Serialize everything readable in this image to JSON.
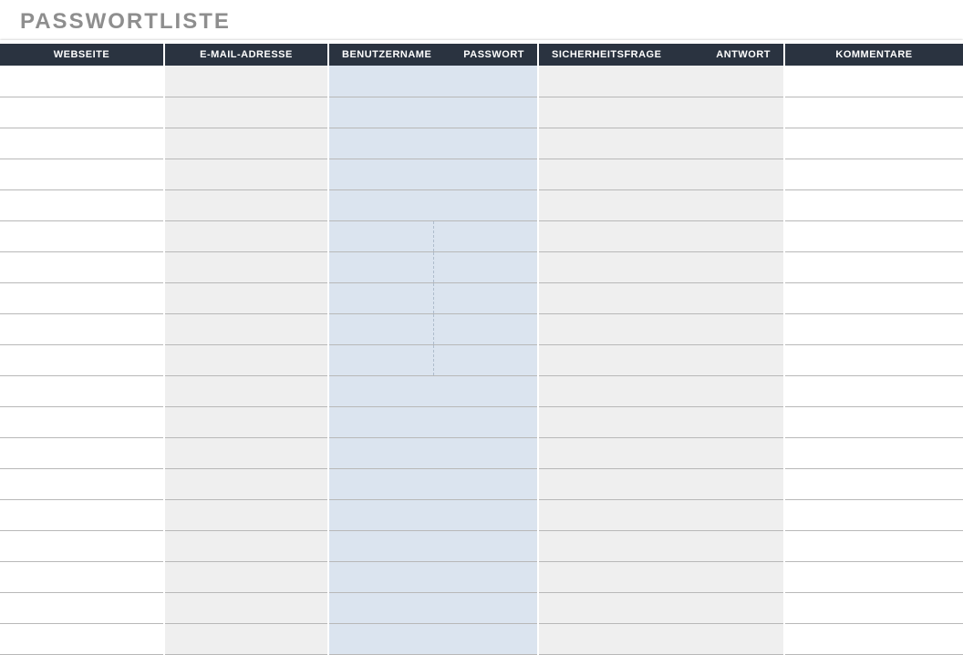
{
  "title": "PASSWORTLISTE",
  "headers": {
    "webseite": "WEBSEITE",
    "email": "E-MAIL-ADRESSE",
    "benutzername": "BENUTZERNAME",
    "passwort": "PASSWORT",
    "sicherheitsfrage": "SICHERHEITSFRAGE",
    "antwort": "ANTWORT",
    "kommentare": "KOMMENTARE"
  },
  "rows": [
    {
      "webseite": "",
      "email": "",
      "benutzername": "",
      "passwort": "",
      "sicherheitsfrage": "",
      "antwort": "",
      "kommentare": ""
    },
    {
      "webseite": "",
      "email": "",
      "benutzername": "",
      "passwort": "",
      "sicherheitsfrage": "",
      "antwort": "",
      "kommentare": ""
    },
    {
      "webseite": "",
      "email": "",
      "benutzername": "",
      "passwort": "",
      "sicherheitsfrage": "",
      "antwort": "",
      "kommentare": ""
    },
    {
      "webseite": "",
      "email": "",
      "benutzername": "",
      "passwort": "",
      "sicherheitsfrage": "",
      "antwort": "",
      "kommentare": ""
    },
    {
      "webseite": "",
      "email": "",
      "benutzername": "",
      "passwort": "",
      "sicherheitsfrage": "",
      "antwort": "",
      "kommentare": ""
    },
    {
      "webseite": "",
      "email": "",
      "benutzername": "",
      "passwort": "",
      "sicherheitsfrage": "",
      "antwort": "",
      "kommentare": ""
    },
    {
      "webseite": "",
      "email": "",
      "benutzername": "",
      "passwort": "",
      "sicherheitsfrage": "",
      "antwort": "",
      "kommentare": ""
    },
    {
      "webseite": "",
      "email": "",
      "benutzername": "",
      "passwort": "",
      "sicherheitsfrage": "",
      "antwort": "",
      "kommentare": ""
    },
    {
      "webseite": "",
      "email": "",
      "benutzername": "",
      "passwort": "",
      "sicherheitsfrage": "",
      "antwort": "",
      "kommentare": ""
    },
    {
      "webseite": "",
      "email": "",
      "benutzername": "",
      "passwort": "",
      "sicherheitsfrage": "",
      "antwort": "",
      "kommentare": ""
    },
    {
      "webseite": "",
      "email": "",
      "benutzername": "",
      "passwort": "",
      "sicherheitsfrage": "",
      "antwort": "",
      "kommentare": ""
    },
    {
      "webseite": "",
      "email": "",
      "benutzername": "",
      "passwort": "",
      "sicherheitsfrage": "",
      "antwort": "",
      "kommentare": ""
    },
    {
      "webseite": "",
      "email": "",
      "benutzername": "",
      "passwort": "",
      "sicherheitsfrage": "",
      "antwort": "",
      "kommentare": ""
    },
    {
      "webseite": "",
      "email": "",
      "benutzername": "",
      "passwort": "",
      "sicherheitsfrage": "",
      "antwort": "",
      "kommentare": ""
    },
    {
      "webseite": "",
      "email": "",
      "benutzername": "",
      "passwort": "",
      "sicherheitsfrage": "",
      "antwort": "",
      "kommentare": ""
    },
    {
      "webseite": "",
      "email": "",
      "benutzername": "",
      "passwort": "",
      "sicherheitsfrage": "",
      "antwort": "",
      "kommentare": ""
    },
    {
      "webseite": "",
      "email": "",
      "benutzername": "",
      "passwort": "",
      "sicherheitsfrage": "",
      "antwort": "",
      "kommentare": ""
    },
    {
      "webseite": "",
      "email": "",
      "benutzername": "",
      "passwort": "",
      "sicherheitsfrage": "",
      "antwort": "",
      "kommentare": ""
    },
    {
      "webseite": "",
      "email": "",
      "benutzername": "",
      "passwort": "",
      "sicherheitsfrage": "",
      "antwort": "",
      "kommentare": ""
    }
  ],
  "splitRows": [
    5,
    6,
    7,
    8,
    9
  ]
}
